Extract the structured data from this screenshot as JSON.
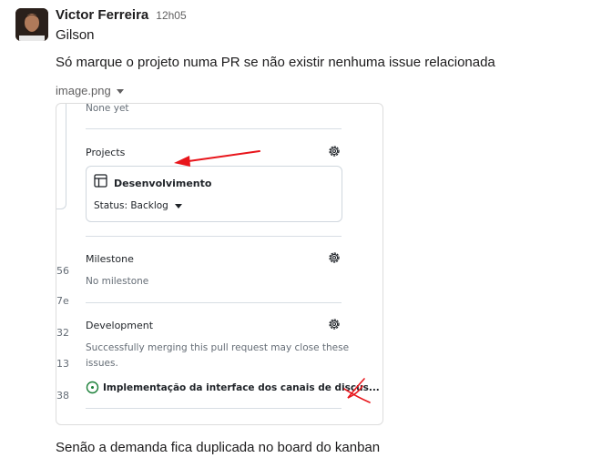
{
  "message": {
    "author": "Victor Ferreira",
    "time": "12h05",
    "lines": [
      "Gilson",
      "Só marque o projeto numa PR se não existir nenhuma issue relacionada"
    ],
    "footer_line": "Senão a demanda fica duplicada no board do kanban"
  },
  "attachment": {
    "file_name": "image.png",
    "screenshot": {
      "top_text": "None yet",
      "line_numbers": [
        "56",
        "7e",
        "32",
        "13",
        "38"
      ],
      "projects": {
        "title": "Projects",
        "card_name": "Desenvolvimento",
        "status_label": "Status: Backlog"
      },
      "milestone": {
        "title": "Milestone",
        "value": "No milestone"
      },
      "development": {
        "title": "Development",
        "note_line1": "Successfully merging this pull request may close these",
        "note_line2": "issues.",
        "issue_title": "Implementação da interface dos canais de discus..."
      },
      "annotation_colors": {
        "arrow": "#e8151b",
        "cross": "#e8151b"
      }
    }
  }
}
